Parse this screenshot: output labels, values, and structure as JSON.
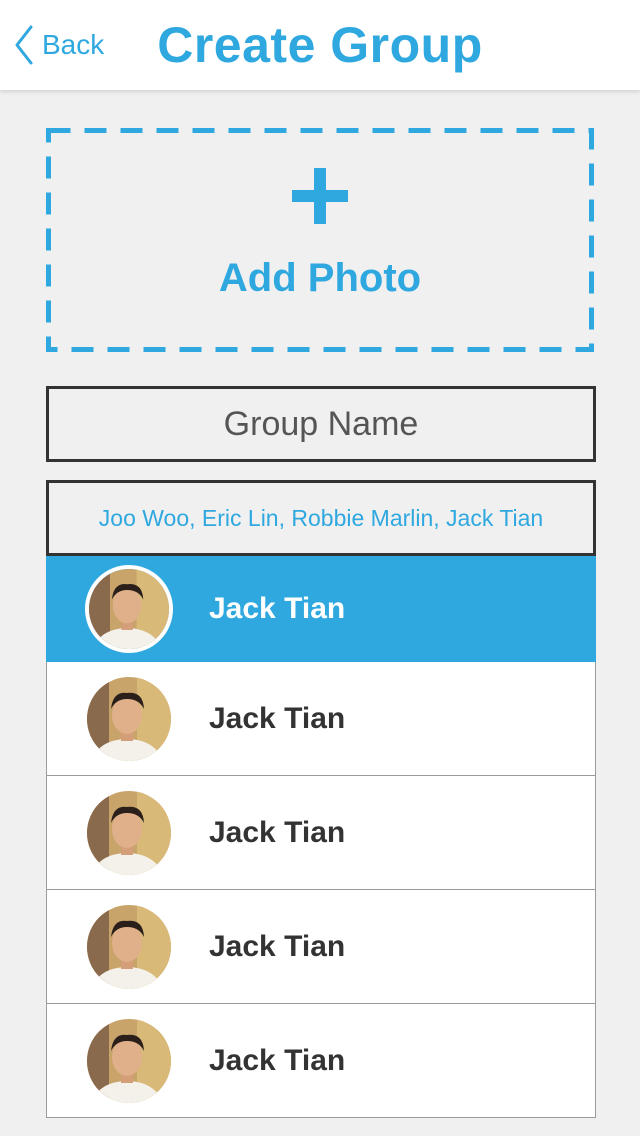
{
  "nav": {
    "back_label": "Back",
    "title": "Create Group"
  },
  "add_photo": {
    "label": "Add Photo",
    "icon": "plus-icon"
  },
  "group_name": {
    "placeholder": "Group Name",
    "value": ""
  },
  "members_summary": "Joo Woo, Eric Lin, Robbie Marlin, Jack Tian",
  "contacts": [
    {
      "name": "Jack Tian",
      "selected": true
    },
    {
      "name": "Jack Tian",
      "selected": false
    },
    {
      "name": "Jack Tian",
      "selected": false
    },
    {
      "name": "Jack Tian",
      "selected": false
    },
    {
      "name": "Jack Tian",
      "selected": false
    }
  ],
  "colors": {
    "accent": "#2fa8e0",
    "background": "#f0f0f0",
    "text_dark": "#333333"
  }
}
